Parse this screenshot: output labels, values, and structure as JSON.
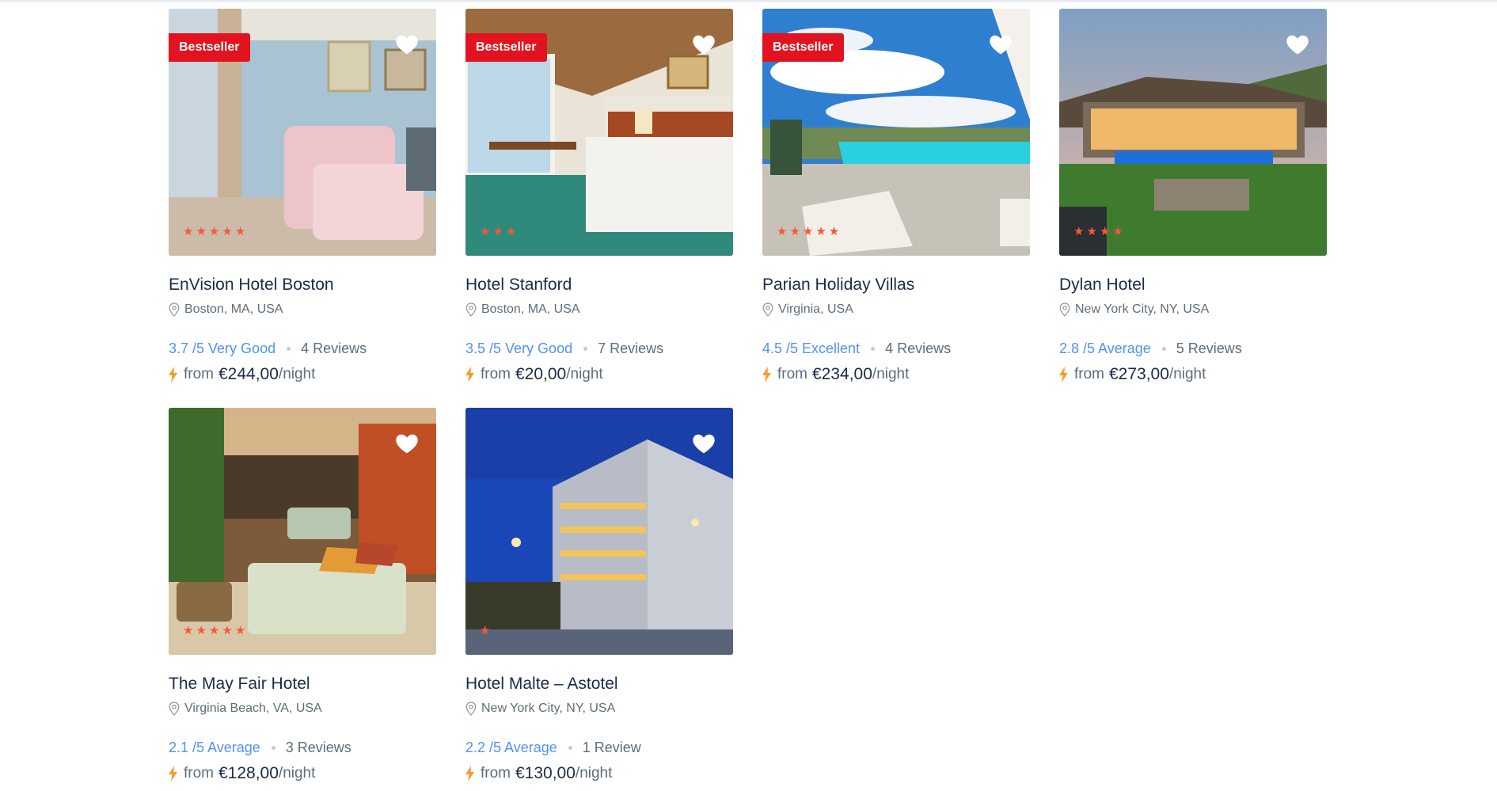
{
  "colors": {
    "badge": "#e2131f",
    "star": "#f5583b",
    "score": "#5191fa",
    "title": "#1a2b49",
    "muted": "#5e6d77"
  },
  "icons": {
    "favorite": "heart-icon",
    "location": "map-pin-icon",
    "deal": "lightning-bolt-icon",
    "star": "star-icon"
  },
  "hotels": [
    {
      "name": "EnVision Hotel Boston",
      "badge": "Bestseller",
      "stars": 5,
      "location": "Boston, MA, USA",
      "score": "3.7 /5 Very Good",
      "reviews": "4 Reviews",
      "from": "from",
      "price": "€244,00",
      "unit": "/night"
    },
    {
      "name": "Hotel Stanford",
      "badge": "Bestseller",
      "stars": 3,
      "location": "Boston, MA, USA",
      "score": "3.5 /5 Very Good",
      "reviews": "7 Reviews",
      "from": "from",
      "price": "€20,00",
      "unit": "/night"
    },
    {
      "name": "Parian Holiday Villas",
      "badge": "Bestseller",
      "stars": 5,
      "location": "Virginia, USA",
      "score": "4.5 /5 Excellent",
      "reviews": "4 Reviews",
      "from": "from",
      "price": "€234,00",
      "unit": "/night"
    },
    {
      "name": "Dylan Hotel",
      "badge": "",
      "stars": 4,
      "location": "New York City, NY, USA",
      "score": "2.8 /5 Average",
      "reviews": "5 Reviews",
      "from": "from",
      "price": "€273,00",
      "unit": "/night"
    },
    {
      "name": "The May Fair Hotel",
      "badge": "",
      "stars": 5,
      "location": "Virginia Beach, VA, USA",
      "score": "2.1 /5 Average",
      "reviews": "3 Reviews",
      "from": "from",
      "price": "€128,00",
      "unit": "/night"
    },
    {
      "name": "Hotel Malte – Astotel",
      "badge": "",
      "stars": 1,
      "location": "New York City, NY, USA",
      "score": "2.2 /5 Average",
      "reviews": "1 Review",
      "from": "from",
      "price": "€130,00",
      "unit": "/night"
    }
  ]
}
